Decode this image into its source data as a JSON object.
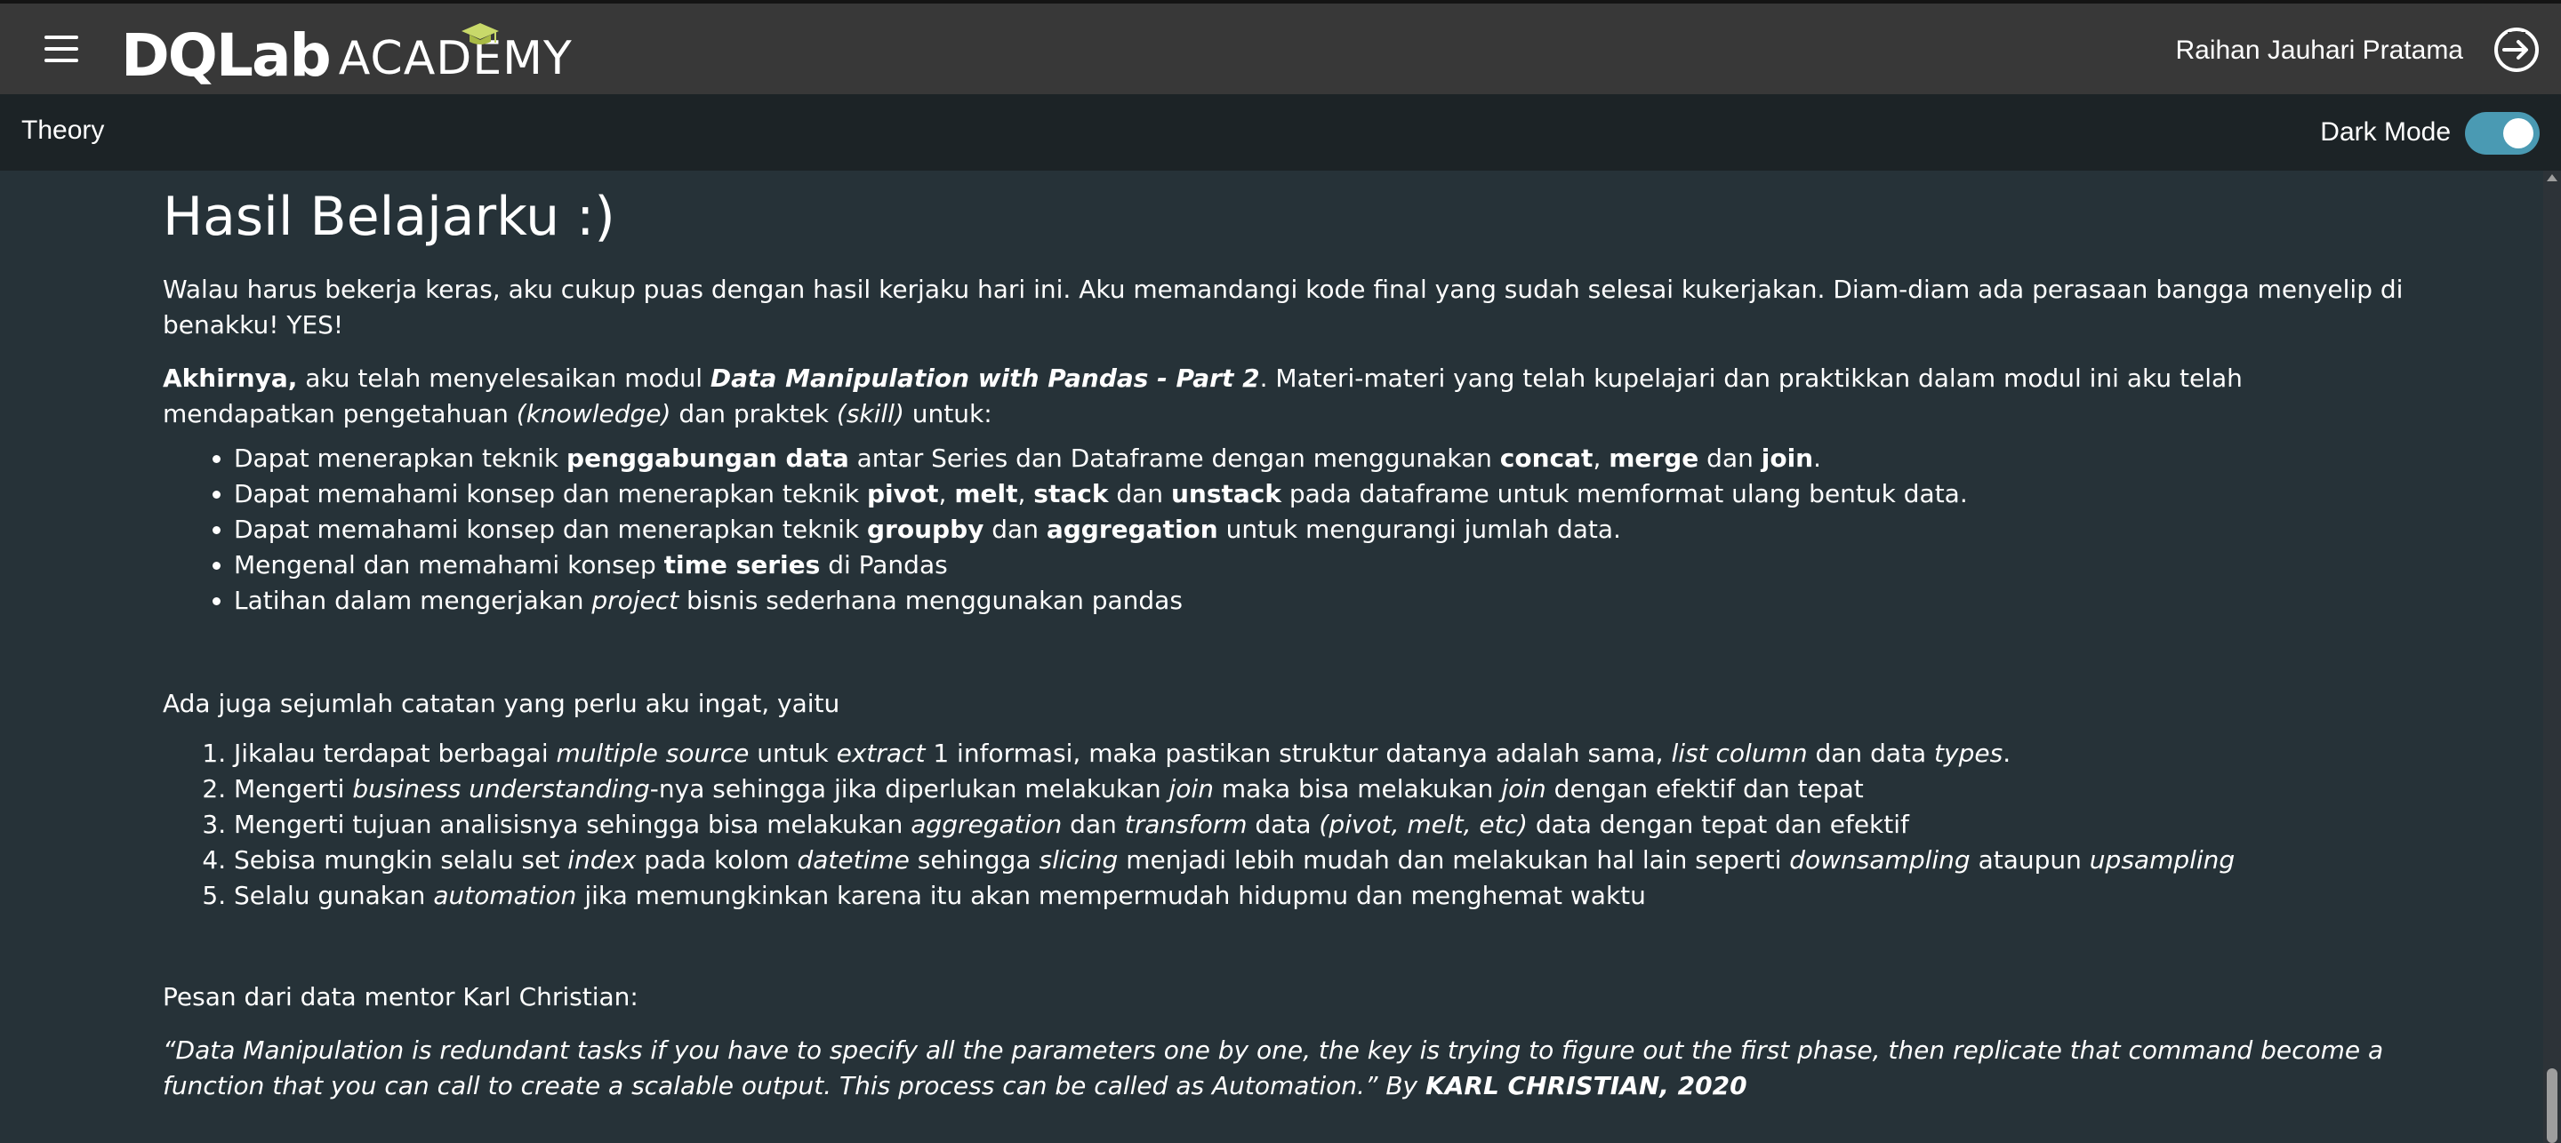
{
  "header": {
    "logo_main": "DQLab",
    "logo_academy": "ACADEMY",
    "user_name": "Raihan Jauhari Pratama"
  },
  "subheader": {
    "title": "Theory",
    "dark_mode_label": "Dark Mode",
    "dark_mode_on": true
  },
  "colors": {
    "topbar": "#383838",
    "subbar": "#1c2326",
    "content_bg": "#263238",
    "toggle_accent": "#4a9ab3"
  },
  "content": {
    "title": "Hasil Belajarku :)",
    "intro": "Walau harus bekerja keras, aku cukup puas dengan hasil kerjaku hari ini. Aku memandangi kode final yang sudah selesai kukerjakan. Diam-diam ada perasaan bangga menyelip di benakku! YES!",
    "summary": {
      "lead_bold": "Akhirnya,",
      "t1": " aku telah menyelesaikan modul ",
      "module_name": "Data Manipulation with Pandas - Part 2",
      "t2": ". Materi-materi yang telah kupelajari dan praktikkan dalam modul ini aku telah mendapatkan pengetahuan ",
      "knowledge": "(knowledge)",
      "t3": " dan praktek ",
      "skill": "(skill)",
      "t4": " untuk:"
    },
    "bullets": [
      {
        "a": "Dapat menerapkan teknik ",
        "b1": "penggabungan data",
        "c": " antar Series dan Dataframe dengan menggunakan ",
        "b2": "concat",
        "d": ", ",
        "b3": "merge",
        "e": " dan ",
        "b4": "join",
        "f": "."
      },
      {
        "a": "Dapat memahami konsep dan menerapkan teknik ",
        "b1": "pivot",
        "c": ", ",
        "b2": "melt",
        "d": ", ",
        "b3": "stack",
        "e": " dan ",
        "b4": "unstack",
        "f": " pada dataframe untuk memformat ulang bentuk data."
      },
      {
        "a": "Dapat memahami konsep dan menerapkan teknik ",
        "b1": "groupby",
        "c": " dan ",
        "b2": "aggregation",
        "d": " untuk mengurangi jumlah data."
      },
      {
        "a": "Mengenal dan memahami konsep ",
        "b1": "time series",
        "c": " di Pandas"
      },
      {
        "a": "Latihan dalam mengerjakan ",
        "i1": "project",
        "c": " bisnis sederhana menggunakan pandas"
      }
    ],
    "notes_intro": "Ada juga sejumlah catatan yang perlu aku ingat, yaitu",
    "notes": [
      {
        "a": "Jikalau terdapat berbagai ",
        "i1": "multiple source",
        "b": " untuk ",
        "i2": "extract",
        "c": " 1 informasi, maka pastikan struktur datanya adalah sama, ",
        "i3": "list column",
        "d": " dan data ",
        "i4": "types",
        "e": "."
      },
      {
        "a": "Mengerti ",
        "i1": "business understanding",
        "b": "-nya sehingga jika diperlukan melakukan ",
        "i2": "join",
        "c": " maka bisa melakukan ",
        "i3": "join",
        "d": " dengan efektif dan tepat"
      },
      {
        "a": "Mengerti tujuan analisisnya sehingga bisa melakukan ",
        "i1": "aggregation",
        "b": " dan ",
        "i2": "transform",
        "c": " data ",
        "i3": "(pivot, melt, etc)",
        "d": " data dengan tepat dan efektif"
      },
      {
        "a": "Sebisa mungkin selalu set ",
        "i1": "index",
        "b": " pada kolom ",
        "i2": "datetime",
        "c": " sehingga ",
        "i3": "slicing",
        "d": " menjadi lebih mudah dan melakukan hal lain seperti ",
        "i4": "downsampling",
        "e": " ataupun ",
        "i5": "upsampling"
      },
      {
        "a": "Selalu gunakan ",
        "i1": "automation",
        "b": " jika memungkinkan karena itu akan mempermudah hidupmu dan menghemat waktu"
      }
    ],
    "mentor_intro": "Pesan dari data mentor Karl Christian:",
    "quote": "“Data Manipulation is redundant tasks if you have to specify all the parameters one by one, the key is trying to figure out the first phase, then replicate that command become a function that you can call to create a scalable output. This process can be called as Automation.”  By ",
    "quote_author": "KARL CHRISTIAN, 2020"
  }
}
